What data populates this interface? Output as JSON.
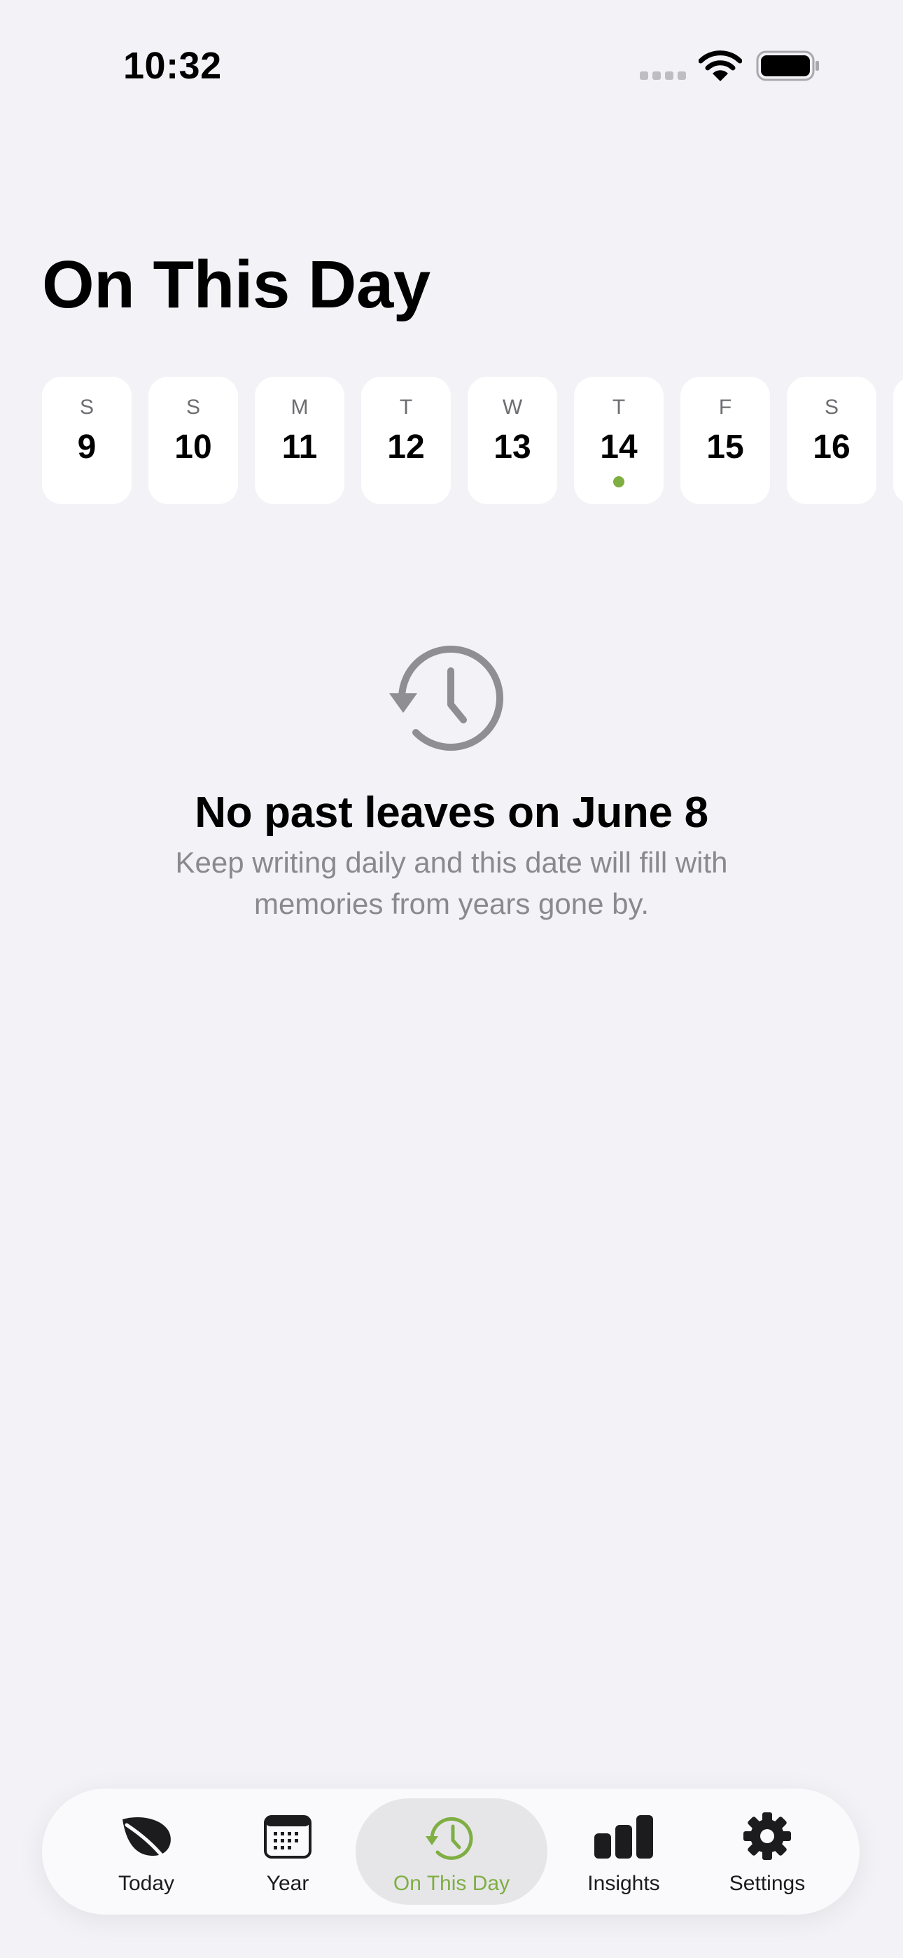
{
  "status_bar": {
    "time": "10:32"
  },
  "header": {
    "title": "On This Day"
  },
  "week_strip": {
    "days": [
      {
        "letter": "S",
        "number": "9",
        "has_entry": false
      },
      {
        "letter": "S",
        "number": "10",
        "has_entry": false
      },
      {
        "letter": "M",
        "number": "11",
        "has_entry": false
      },
      {
        "letter": "T",
        "number": "12",
        "has_entry": false
      },
      {
        "letter": "W",
        "number": "13",
        "has_entry": false
      },
      {
        "letter": "T",
        "number": "14",
        "has_entry": true
      },
      {
        "letter": "F",
        "number": "15",
        "has_entry": false
      },
      {
        "letter": "S",
        "number": "16",
        "has_entry": false
      }
    ],
    "dot_color": "#7FAE42"
  },
  "empty_state": {
    "icon": "history-icon",
    "title": "No past leaves on June 8",
    "message": "Keep writing daily and this date will fill with memories from years gone by."
  },
  "tab_bar": {
    "active_index": 2,
    "tabs": [
      {
        "label": "Today",
        "icon": "leaf-icon"
      },
      {
        "label": "Year",
        "icon": "calendar-icon"
      },
      {
        "label": "On This Day",
        "icon": "history-icon"
      },
      {
        "label": "Insights",
        "icon": "bar-chart-icon"
      },
      {
        "label": "Settings",
        "icon": "gear-icon"
      }
    ]
  },
  "colors": {
    "accent": "#7FAE42",
    "background": "#F2F2F7",
    "secondary_text": "#8A8A8E",
    "icon_gray": "#8E8E93"
  }
}
